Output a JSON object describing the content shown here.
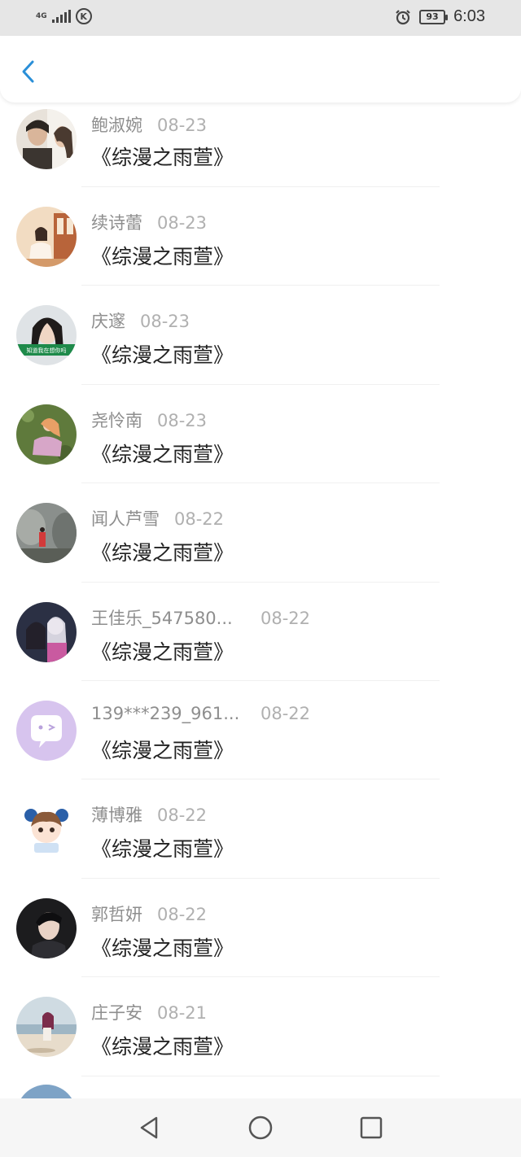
{
  "status_bar": {
    "network": "4G",
    "carrier_badge": "K",
    "battery": "93",
    "time": "6:03"
  },
  "header": {
    "back_icon": "chevron-left-icon"
  },
  "accent_color": "#2a8fd8",
  "rows": [
    {
      "name": "鲍淑婉",
      "date": "08-23",
      "title": "《综漫之雨萱》"
    },
    {
      "name": "续诗蕾",
      "date": "08-23",
      "title": "《综漫之雨萱》"
    },
    {
      "name": "庆邃",
      "date": "08-23",
      "title": "《综漫之雨萱》",
      "avatar_caption": "知道我在想你吗"
    },
    {
      "name": "尧怜南",
      "date": "08-23",
      "title": "《综漫之雨萱》"
    },
    {
      "name": "闻人芦雪",
      "date": "08-22",
      "title": "《综漫之雨萱》"
    },
    {
      "name": "王佳乐_547580...",
      "date": "08-22",
      "title": "《综漫之雨萱》"
    },
    {
      "name": "139***239_961...",
      "date": "08-22",
      "title": "《综漫之雨萱》"
    },
    {
      "name": "薄博雅",
      "date": "08-22",
      "title": "《综漫之雨萱》"
    },
    {
      "name": "郭哲妍",
      "date": "08-22",
      "title": "《综漫之雨萱》"
    },
    {
      "name": "庄子安",
      "date": "08-21",
      "title": "《综漫之雨萱》"
    }
  ],
  "nav": {
    "back": "triangle-back-icon",
    "home": "circle-home-icon",
    "recent": "square-recent-icon"
  }
}
